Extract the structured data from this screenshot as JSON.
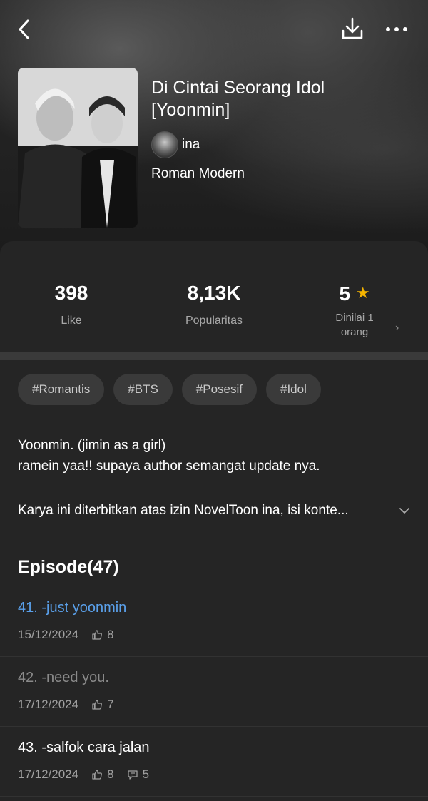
{
  "header": {
    "back_icon": "chevron-left-icon",
    "download_icon": "download-icon",
    "more_icon": "more-horizontal-icon"
  },
  "book": {
    "title": "Di Cintai Seorang Idol [Yoonmin]",
    "author": "ina",
    "genre": "Roman Modern"
  },
  "stats": {
    "likes_value": "398",
    "likes_label": "Like",
    "popularity_value": "8,13K",
    "popularity_label": "Popularitas",
    "rating_value": "5",
    "rating_label": "Dinilai 1 orang",
    "star_color": "#f5b400"
  },
  "tags": [
    "#Romantis",
    "#BTS",
    "#Posesif",
    "#Idol"
  ],
  "description": {
    "line1": "Yoonmin. (jimin as a girl)",
    "line2": "ramein yaa!! supaya author semangat update nya.",
    "notice": "Karya ini diterbitkan atas izin NovelToon ina, isi konte..."
  },
  "episodes": {
    "heading": "Episode(47)",
    "items": [
      {
        "title": "41. -just yoonmin",
        "date": "15/12/2024",
        "likes": "8",
        "comments": "",
        "color": "#5aa0ea"
      },
      {
        "title": "42. -need you.",
        "date": "17/12/2024",
        "likes": "7",
        "comments": "",
        "color": "#8a8a8a"
      },
      {
        "title": "43. -salfok cara jalan",
        "date": "17/12/2024",
        "likes": "8",
        "comments": "5",
        "color": "#ffffff"
      }
    ]
  }
}
